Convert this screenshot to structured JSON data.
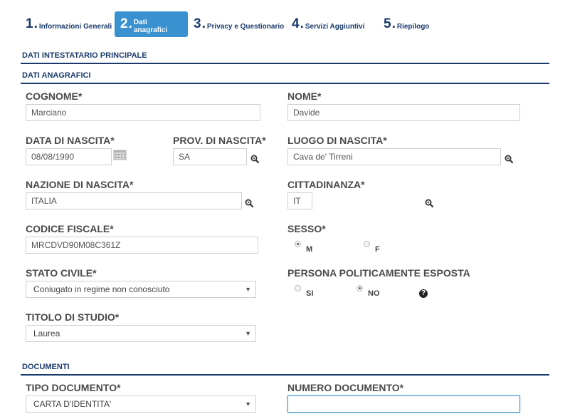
{
  "stepper": [
    {
      "num": "1",
      "label": "Informazioni Generali"
    },
    {
      "num": "2",
      "label": "Dati anagrafici"
    },
    {
      "num": "3",
      "label": "Privacy e Questionario"
    },
    {
      "num": "4",
      "label": "Servizi Aggiuntivi"
    },
    {
      "num": "5",
      "label": "Riepilogo"
    }
  ],
  "sections": {
    "intestatario": "DATI INTESTATARIO PRINCIPALE",
    "anagrafici": "DATI ANAGRAFICI",
    "documenti": "DOCUMENTI"
  },
  "fields": {
    "cognome": {
      "label": "COGNOME*",
      "value": "Marciano"
    },
    "nome": {
      "label": "NOME*",
      "value": "Davide"
    },
    "data_nascita": {
      "label": "DATA DI NASCITA*",
      "value": "08/08/1990"
    },
    "prov_nascita": {
      "label": "PROV. DI NASCITA*",
      "value": "SA"
    },
    "luogo_nascita": {
      "label": "LUOGO DI NASCITA*",
      "value": "Cava de' Tirreni"
    },
    "nazione_nascita": {
      "label": "NAZIONE DI NASCITA*",
      "value": "ITALIA"
    },
    "cittadinanza": {
      "label": "CITTADINANZA*",
      "value": "IT"
    },
    "codice_fiscale": {
      "label": "CODICE FISCALE*",
      "value": "MRCDVD90M08C361Z"
    },
    "sesso": {
      "label": "SESSO*",
      "options": [
        "M",
        "F"
      ],
      "selected": "M"
    },
    "stato_civile": {
      "label": "STATO CIVILE*",
      "value": "Coniugato in regime non conosciuto"
    },
    "pep": {
      "label": "PERSONA POLITICAMENTE ESPOSTA",
      "options": [
        "SI",
        "NO"
      ],
      "selected": "NO"
    },
    "titolo_studio": {
      "label": "TITOLO DI STUDIO*",
      "value": "Laurea"
    },
    "tipo_documento": {
      "label": "TIPO DOCUMENTO*",
      "value": "CARTA D'IDENTITA'"
    },
    "numero_documento": {
      "label": "NUMERO DOCUMENTO*",
      "value": ""
    }
  },
  "icons": {
    "lookup": "magnifier-icon",
    "calendar": "calendar-icon",
    "help": "question-icon",
    "caret": "chevron-down-icon"
  },
  "colors": {
    "brand_navy": "#1b3a6b",
    "active_step": "#3a91cf"
  },
  "caret_glyph": "▼",
  "help_glyph": "?"
}
